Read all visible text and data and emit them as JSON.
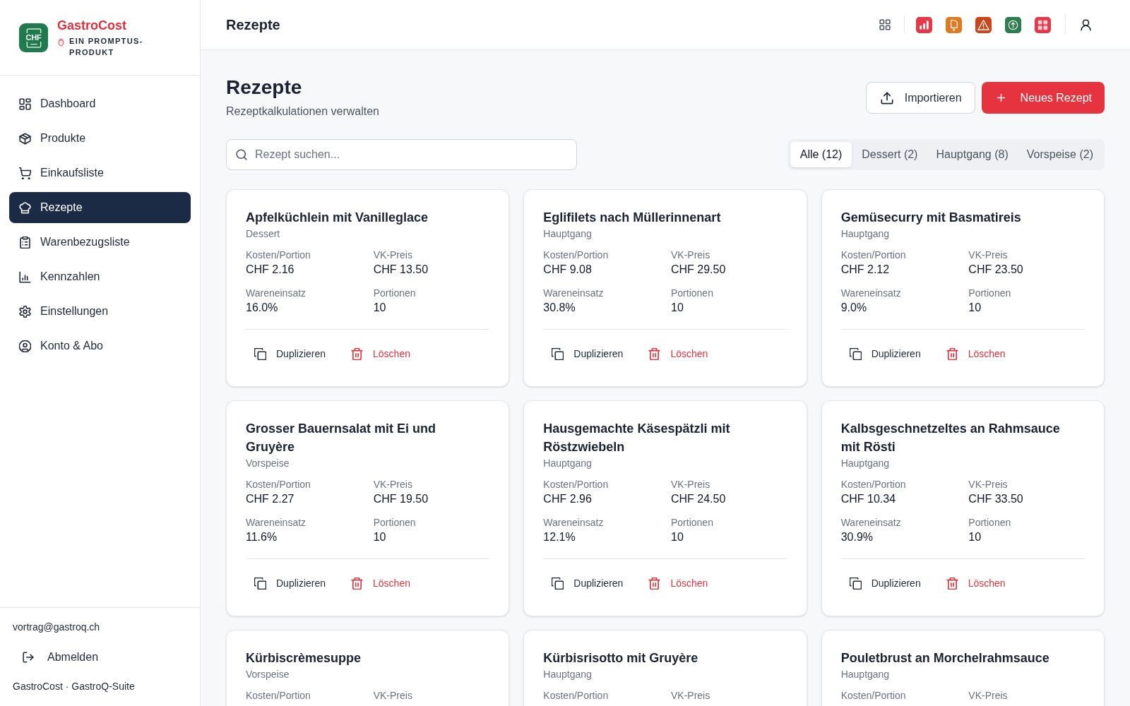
{
  "app": {
    "logo_text": "CHF",
    "name": "GastroCost",
    "tagline": "EIN PROMPTUS-PRODUKT"
  },
  "sidebar": {
    "items": [
      {
        "label": "Dashboard",
        "selected": false
      },
      {
        "label": "Produkte",
        "selected": false
      },
      {
        "label": "Einkaufsliste",
        "selected": false
      },
      {
        "label": "Rezepte",
        "selected": true
      },
      {
        "label": "Warenbezugsliste",
        "selected": false
      },
      {
        "label": "Kennzahlen",
        "selected": false
      },
      {
        "label": "Einstellungen",
        "selected": false
      },
      {
        "label": "Konto & Abo",
        "selected": false
      }
    ],
    "email": "vortrag@gastroq.ch",
    "logout": "Abmelden",
    "footer": "GastroCost · GastroQ-Suite"
  },
  "header": {
    "title": "Rezepte"
  },
  "page": {
    "title": "Rezepte",
    "subtitle": "Rezeptkalkulationen verwalten",
    "actions": [
      {
        "kind": "import",
        "label": "Importieren"
      },
      {
        "kind": "new",
        "label": "Neues Rezept"
      }
    ]
  },
  "search": {
    "placeholder": "Rezept suchen..."
  },
  "filters": [
    {
      "label": "Alle (12)",
      "selected": true
    },
    {
      "label": "Dessert (2)",
      "selected": false
    },
    {
      "label": "Hauptgang (8)",
      "selected": false
    },
    {
      "label": "Vorspeise (2)",
      "selected": false
    }
  ],
  "recipes": [
    {
      "name": "Apfelküchlein mit Vanilleglace",
      "category": "Dessert",
      "stats": [
        {
          "label": "Kosten/Portion",
          "value": "CHF 2.16"
        },
        {
          "label": "VK-Preis",
          "value": "CHF 13.50"
        },
        {
          "label": "Wareneinsatz",
          "value": "16.0%"
        },
        {
          "label": "Portionen",
          "value": "10"
        }
      ],
      "actions": [
        {
          "kind": "duplicate",
          "label": "Duplizieren"
        },
        {
          "kind": "delete",
          "label": "Löschen"
        }
      ]
    },
    {
      "name": "Eglifilets nach Müllerinnenart",
      "category": "Hauptgang",
      "stats": [
        {
          "label": "Kosten/Portion",
          "value": "CHF 9.08"
        },
        {
          "label": "VK-Preis",
          "value": "CHF 29.50"
        },
        {
          "label": "Wareneinsatz",
          "value": "30.8%"
        },
        {
          "label": "Portionen",
          "value": "10"
        }
      ],
      "actions": [
        {
          "kind": "duplicate",
          "label": "Duplizieren"
        },
        {
          "kind": "delete",
          "label": "Löschen"
        }
      ]
    },
    {
      "name": "Gemüsecurry mit Basmatireis",
      "category": "Hauptgang",
      "stats": [
        {
          "label": "Kosten/Portion",
          "value": "CHF 2.12"
        },
        {
          "label": "VK-Preis",
          "value": "CHF 23.50"
        },
        {
          "label": "Wareneinsatz",
          "value": "9.0%"
        },
        {
          "label": "Portionen",
          "value": "10"
        }
      ],
      "actions": [
        {
          "kind": "duplicate",
          "label": "Duplizieren"
        },
        {
          "kind": "delete",
          "label": "Löschen"
        }
      ]
    },
    {
      "name": "Grosser Bauernsalat mit Ei und Gruyère",
      "category": "Vorspeise",
      "stats": [
        {
          "label": "Kosten/Portion",
          "value": "CHF 2.27"
        },
        {
          "label": "VK-Preis",
          "value": "CHF 19.50"
        },
        {
          "label": "Wareneinsatz",
          "value": "11.6%"
        },
        {
          "label": "Portionen",
          "value": "10"
        }
      ],
      "actions": [
        {
          "kind": "duplicate",
          "label": "Duplizieren"
        },
        {
          "kind": "delete",
          "label": "Löschen"
        }
      ]
    },
    {
      "name": "Hausgemachte Käsespätzli mit Röstzwiebeln",
      "category": "Hauptgang",
      "stats": [
        {
          "label": "Kosten/Portion",
          "value": "CHF 2.96"
        },
        {
          "label": "VK-Preis",
          "value": "CHF 24.50"
        },
        {
          "label": "Wareneinsatz",
          "value": "12.1%"
        },
        {
          "label": "Portionen",
          "value": "10"
        }
      ],
      "actions": [
        {
          "kind": "duplicate",
          "label": "Duplizieren"
        },
        {
          "kind": "delete",
          "label": "Löschen"
        }
      ]
    },
    {
      "name": "Kalbsgeschnetzeltes an Rahmsauce mit Rösti",
      "category": "Hauptgang",
      "stats": [
        {
          "label": "Kosten/Portion",
          "value": "CHF 10.34"
        },
        {
          "label": "VK-Preis",
          "value": "CHF 33.50"
        },
        {
          "label": "Wareneinsatz",
          "value": "30.9%"
        },
        {
          "label": "Portionen",
          "value": "10"
        }
      ],
      "actions": [
        {
          "kind": "duplicate",
          "label": "Duplizieren"
        },
        {
          "kind": "delete",
          "label": "Löschen"
        }
      ]
    },
    {
      "name": "Kürbiscrèmesuppe",
      "category": "Vorspeise",
      "stats": [
        {
          "label": "Kosten/Portion"
        },
        {
          "label": "VK-Preis"
        }
      ]
    },
    {
      "name": "Kürbisrisotto mit Gruyère",
      "category": "Hauptgang",
      "stats": [
        {
          "label": "Kosten/Portion"
        },
        {
          "label": "VK-Preis"
        }
      ]
    },
    {
      "name": "Pouletbrust an Morchelrahmsauce",
      "category": "Hauptgang",
      "stats": [
        {
          "label": "Kosten/Portion"
        },
        {
          "label": "VK-Preis"
        }
      ]
    }
  ]
}
